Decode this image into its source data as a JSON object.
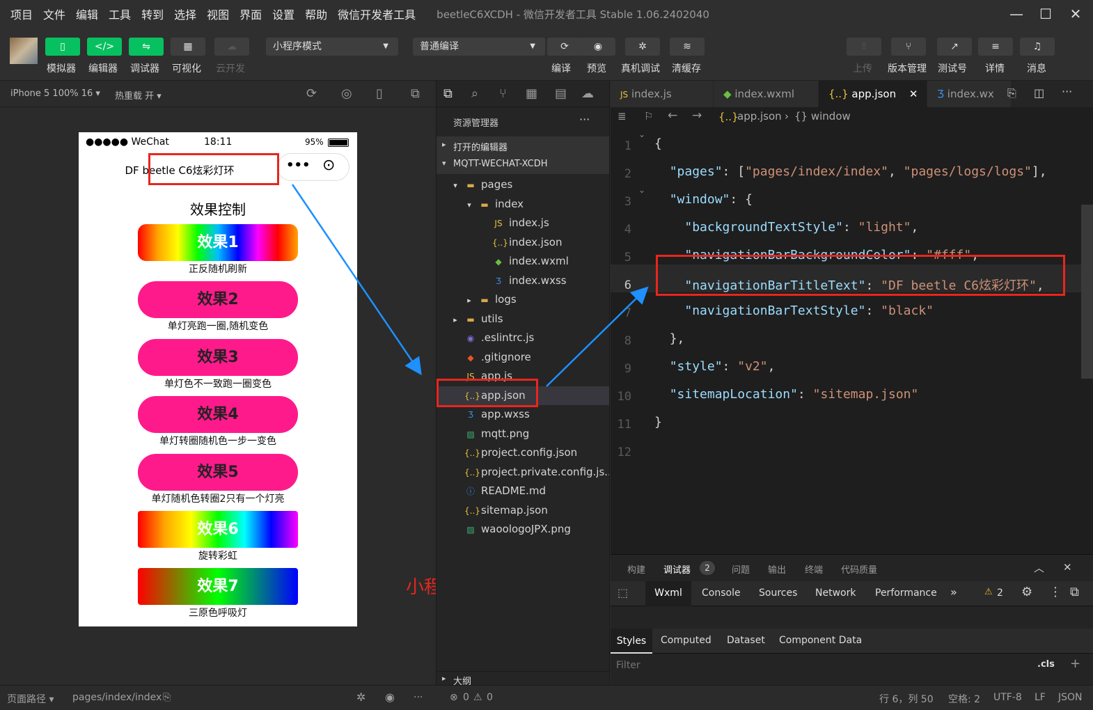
{
  "menubar": {
    "items": [
      "项目",
      "文件",
      "编辑",
      "工具",
      "转到",
      "选择",
      "视图",
      "界面",
      "设置",
      "帮助",
      "微信开发者工具"
    ],
    "title": "beetleC6XCDH - 微信开发者工具 Stable 1.06.2402040"
  },
  "toolbar": {
    "left_buttons": [
      "模拟器",
      "编辑器",
      "调试器",
      "可视化",
      "云开发"
    ],
    "mode_select": "小程序模式",
    "compile_select": "普通编译",
    "mid_buttons": [
      "编译",
      "预览",
      "真机调试",
      "清缓存"
    ],
    "right_buttons": [
      "上传",
      "版本管理",
      "测试号",
      "详情",
      "消息"
    ]
  },
  "simulator": {
    "device": "iPhone 5 100% 16 ▾",
    "hot_reload": "热重载 开 ▾",
    "status_signal": "●●●●● WeChat",
    "status_time": "18:11",
    "status_battery": "95%",
    "nav_title": "DF beetle C6炫彩灯环",
    "page_heading": "效果控制",
    "effects": [
      {
        "label": "效果1",
        "desc": "正反随机刷新",
        "style": "rainbow"
      },
      {
        "label": "效果2",
        "desc": "单灯亮跑一圈,随机变色",
        "style": "pink"
      },
      {
        "label": "效果3",
        "desc": "单灯色不一致跑一圈变色",
        "style": "pink"
      },
      {
        "label": "效果4",
        "desc": "单灯转圈随机色一步一变色",
        "style": "pink"
      },
      {
        "label": "效果5",
        "desc": "单灯随机色转圈2只有一个灯亮",
        "style": "pink"
      },
      {
        "label": "效果6",
        "desc": "旋转彩虹",
        "style": "rainbow2"
      },
      {
        "label": "效果7",
        "desc": "三原色呼吸灯",
        "style": "rgb"
      }
    ]
  },
  "annotation": "小程序显示名称",
  "explorer": {
    "title": "资源管理器",
    "open_editors": "打开的编辑器",
    "project": "MQTT-WECHAT-XCDH",
    "tree": [
      {
        "name": "pages",
        "indent": 1,
        "icon": "folder",
        "arrow": "▾"
      },
      {
        "name": "index",
        "indent": 2,
        "icon": "folder",
        "arrow": "▾"
      },
      {
        "name": "index.js",
        "indent": 3,
        "icon": "js",
        "arrow": ""
      },
      {
        "name": "index.json",
        "indent": 3,
        "icon": "json",
        "arrow": ""
      },
      {
        "name": "index.wxml",
        "indent": 3,
        "icon": "wxml",
        "arrow": ""
      },
      {
        "name": "index.wxss",
        "indent": 3,
        "icon": "wxss",
        "arrow": ""
      },
      {
        "name": "logs",
        "indent": 2,
        "icon": "folder",
        "arrow": "▸"
      },
      {
        "name": "utils",
        "indent": 1,
        "icon": "folder",
        "arrow": "▸"
      },
      {
        "name": ".eslintrc.js",
        "indent": 1,
        "icon": "eslint",
        "arrow": ""
      },
      {
        "name": ".gitignore",
        "indent": 1,
        "icon": "git",
        "arrow": ""
      },
      {
        "name": "app.js",
        "indent": 1,
        "icon": "js",
        "arrow": ""
      },
      {
        "name": "app.json",
        "indent": 1,
        "icon": "json",
        "arrow": ""
      },
      {
        "name": "app.wxss",
        "indent": 1,
        "icon": "wxss",
        "arrow": ""
      },
      {
        "name": "mqtt.png",
        "indent": 1,
        "icon": "png",
        "arrow": ""
      },
      {
        "name": "project.config.json",
        "indent": 1,
        "icon": "json",
        "arrow": ""
      },
      {
        "name": "project.private.config.js...",
        "indent": 1,
        "icon": "json",
        "arrow": ""
      },
      {
        "name": "README.md",
        "indent": 1,
        "icon": "info",
        "arrow": ""
      },
      {
        "name": "sitemap.json",
        "indent": 1,
        "icon": "json",
        "arrow": ""
      },
      {
        "name": "waoologoJPX.png",
        "indent": 1,
        "icon": "png",
        "arrow": ""
      }
    ],
    "outline": "大纲"
  },
  "editor": {
    "tabs": [
      "index.js",
      "index.wxml",
      "app.json",
      "index.wx"
    ],
    "breadcrumb_file": "app.json",
    "breadcrumb_sym": "{} window",
    "lines": [
      [
        [
          "{",
          "p"
        ]
      ],
      [
        [
          "  ",
          "p"
        ],
        [
          "\"pages\"",
          "k"
        ],
        [
          ": [",
          "p"
        ],
        [
          "\"pages/index/index\"",
          "s"
        ],
        [
          ", ",
          "p"
        ],
        [
          "\"pages/logs/logs\"",
          "s"
        ],
        [
          "],",
          "p"
        ]
      ],
      [
        [
          "  ",
          "p"
        ],
        [
          "\"window\"",
          "k"
        ],
        [
          ": {",
          "p"
        ]
      ],
      [
        [
          "    ",
          "p"
        ],
        [
          "\"backgroundTextStyle\"",
          "k"
        ],
        [
          ": ",
          "p"
        ],
        [
          "\"light\"",
          "s"
        ],
        [
          ",",
          "p"
        ]
      ],
      [
        [
          "    ",
          "p"
        ],
        [
          "\"navigationBarBackgroundColor\"",
          "k"
        ],
        [
          ": ",
          "p"
        ],
        [
          "\"#fff\"",
          "s"
        ],
        [
          ",",
          "p"
        ]
      ],
      [
        [
          "    ",
          "p"
        ],
        [
          "\"navigationBarTitleText\"",
          "k"
        ],
        [
          ": ",
          "p"
        ],
        [
          "\"DF beetle C6炫彩灯环\"",
          "s"
        ],
        [
          ",",
          "p"
        ]
      ],
      [
        [
          "    ",
          "p"
        ],
        [
          "\"navigationBarTextStyle\"",
          "k"
        ],
        [
          ": ",
          "p"
        ],
        [
          "\"black\"",
          "s"
        ]
      ],
      [
        [
          "  ",
          "p"
        ],
        [
          "},",
          "p"
        ]
      ],
      [
        [
          "  ",
          "p"
        ],
        [
          "\"style\"",
          "k"
        ],
        [
          ": ",
          "p"
        ],
        [
          "\"v2\"",
          "s"
        ],
        [
          ",",
          "p"
        ]
      ],
      [
        [
          "  ",
          "p"
        ],
        [
          "\"sitemapLocation\"",
          "k"
        ],
        [
          ": ",
          "p"
        ],
        [
          "\"sitemap.json\"",
          "s"
        ]
      ],
      [
        [
          "}",
          "p"
        ]
      ],
      []
    ]
  },
  "devtools": {
    "top_tabs": [
      "构建",
      "调试器",
      "问题",
      "输出",
      "终端",
      "代码质量"
    ],
    "badge": "2",
    "panels": [
      "Wxml",
      "Console",
      "Sources",
      "Network",
      "Performance"
    ],
    "warn": "2",
    "style_tabs": [
      "Styles",
      "Computed",
      "Dataset",
      "Component Data"
    ],
    "filter_placeholder": "Filter",
    "cls": ".cls"
  },
  "statusbar": {
    "path_label": "页面路径 ▾",
    "path": "pages/index/index",
    "errors": "0",
    "warnings": "0",
    "cursor": "行 6，列 50",
    "indent": "空格: 2",
    "encoding": "UTF-8",
    "eol": "LF",
    "lang": "JSON"
  },
  "colors": {
    "accent_green": "#07c160",
    "pink": "#ff1a8c",
    "highlight_red": "#e8261d",
    "arrow_blue": "#1e90ff"
  }
}
